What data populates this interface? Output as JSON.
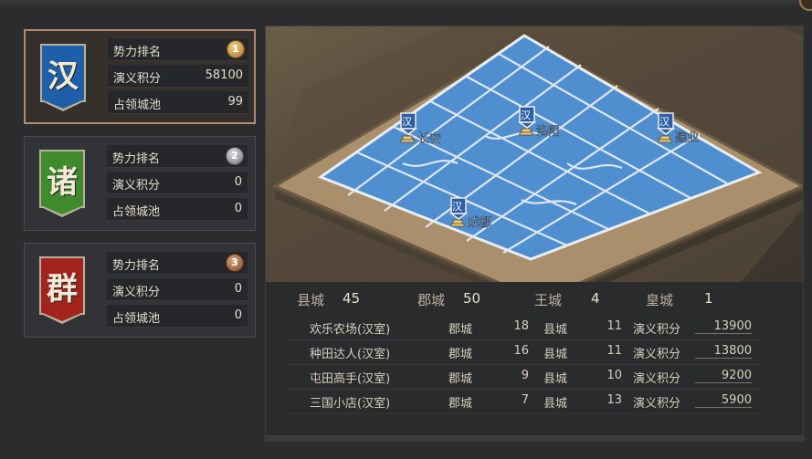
{
  "factions": [
    {
      "name": "汉",
      "rank_label": "势力排名",
      "rank": "1",
      "score_label": "演义积分",
      "score": "58100",
      "cities_label": "占领城池",
      "cities": "99"
    },
    {
      "name": "诸",
      "rank_label": "势力排名",
      "rank": "2",
      "score_label": "演义积分",
      "score": "0",
      "cities_label": "占领城池",
      "cities": "0"
    },
    {
      "name": "群",
      "rank_label": "势力排名",
      "rank": "3",
      "score_label": "演义积分",
      "score": "0",
      "cities_label": "占领城池",
      "cities": "0"
    }
  ],
  "map": {
    "cities": [
      {
        "flag": "汉",
        "name": "长安"
      },
      {
        "flag": "汉",
        "name": "洛阳"
      },
      {
        "flag": "汉",
        "name": "建业"
      },
      {
        "flag": "汉",
        "name": "成都"
      }
    ]
  },
  "stats": {
    "county_label": "县城",
    "county": "45",
    "commandery_label": "郡城",
    "commandery": "50",
    "king_label": "王城",
    "king": "4",
    "imperial_label": "皇城",
    "imperial": "1"
  },
  "players": [
    {
      "name": "欢乐农场(汉室)",
      "jun_label": "郡城",
      "jun": "18",
      "xian_label": "县城",
      "xian": "11",
      "score_label": "演义积分",
      "score": "13900"
    },
    {
      "name": "种田达人(汉室)",
      "jun_label": "郡城",
      "jun": "16",
      "xian_label": "县城",
      "xian": "11",
      "score_label": "演义积分",
      "score": "13800"
    },
    {
      "name": "屯田高手(汉室)",
      "jun_label": "郡城",
      "jun": "9",
      "xian_label": "县城",
      "xian": "10",
      "score_label": "演义积分",
      "score": "9200"
    },
    {
      "name": "三国小店(汉室)",
      "jun_label": "郡城",
      "jun": "7",
      "xian_label": "县城",
      "xian": "13",
      "score_label": "演义积分",
      "score": "5900"
    }
  ],
  "colors": {
    "han": "#1f5ea8",
    "zhu": "#3f8a2c",
    "qun": "#a3241d",
    "territory": "#4f8fd0",
    "board": "#a98f6c"
  }
}
